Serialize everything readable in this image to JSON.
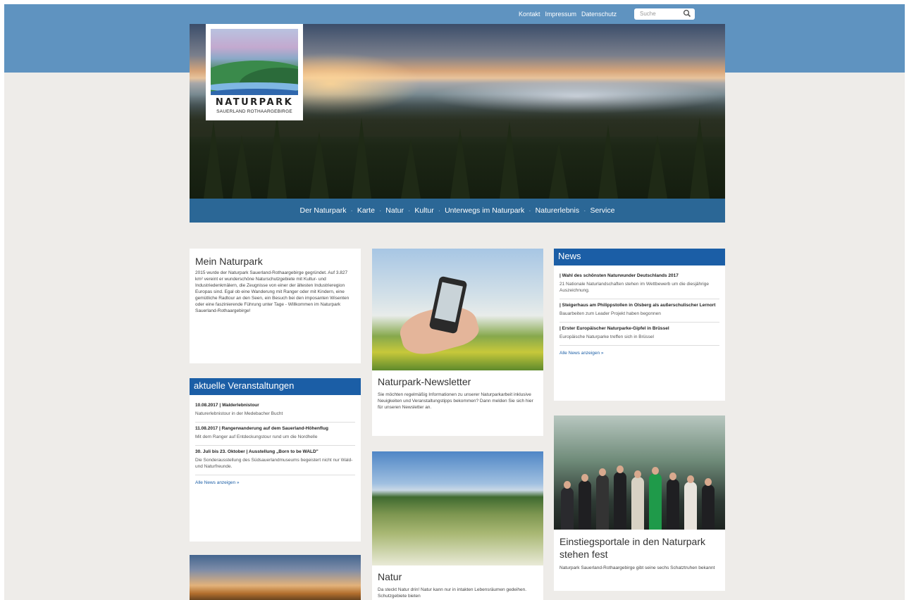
{
  "utility_nav": {
    "links": [
      "Kontakt",
      "Impressum",
      "Datenschutz"
    ],
    "search_placeholder": "Suche"
  },
  "logo": {
    "name": "NATURPARK",
    "subtitle": "SAUERLAND ROTHAARGEBIRGE"
  },
  "main_nav": {
    "items": [
      "Der Naturpark",
      "Karte",
      "Natur",
      "Kultur",
      "Unterwegs im Naturpark",
      "Naturerlebnis",
      "Service"
    ],
    "separator": "·"
  },
  "mein_naturpark": {
    "title": "Mein Naturpark",
    "text": "2015 wurde der Naturpark Sauerland-Rothaargebirge gegründet. Auf 3.827 km² vereint er wunderschöne Naturschutzgebiete mit Kultur- und Industriedenkmälern, die Zeugnisse von einer der ältesten Industrieregion Europas sind. Egal ob eine Wanderung mit Ranger oder mit Kindern, eine gemütliche Radtour an den Seen, ein Besuch bei den imposanten Wisenten oder eine faszinierende Führung unter Tage - Willkommen im Naturpark Sauerland-Rothaargebirge!"
  },
  "events": {
    "title": "aktuelle Veranstaltungen",
    "items": [
      {
        "title": "10.08.2017 | Walderlebnistour",
        "desc": "Naturerlebnistour in der Medebacher Bucht"
      },
      {
        "title": "11.08.2017 | Rangerwanderung auf dem Sauerland-Höhenflug",
        "desc": "Mit dem Ranger auf Entdeckungstour rund um die Nordhelle"
      },
      {
        "title": "30. Juli bis 23. Oktober | Ausstellung „Born to be WALD\"",
        "desc": "Die Sonderausstellung des Südsauerlandmuseums begeistert nicht nur Wald- und Naturfreunde."
      }
    ],
    "more": "Alle News anzeigen »"
  },
  "newsletter": {
    "title": "Naturpark-Newsletter",
    "text": "Sie möchten regelmäßig Informationen zu unserer Naturparkarbeit inklusive Neuigkeiten und Veranstaltungstipps bekommen? Dann melden Sie sich hier für unseren Newsletter an."
  },
  "natur": {
    "title": "Natur",
    "text": "Da steckt Natur drin! Natur kann nur in intakten Lebensräumen gedeihen. Schutzgebiete bieten"
  },
  "news": {
    "title": "News",
    "items": [
      {
        "title": "| Wahl des schönsten Naturwunder Deutschlands 2017",
        "desc": "21 Nationale Naturlandschaften stehen im Wettbewerb um die diesjährige Auszeichnung."
      },
      {
        "title": "| Steigerhaus am Philippstollen in Olsberg als außerschulischer Lernort",
        "desc": "Bauarbeiten zum Leader Projekt haben begonnen"
      },
      {
        "title": "| Erster Europäischer Naturparke-Gipfel in Brüssel",
        "desc": "Europäische Naturparke treffen sich in Brüssel"
      }
    ],
    "more": "Alle News anzeigen »"
  },
  "portale": {
    "title": "Einstiegsportale in den Naturpark stehen fest",
    "text": "Naturpark Sauerland-Rothaargebirge gibt seine sechs Schatztruhen bekannt"
  }
}
